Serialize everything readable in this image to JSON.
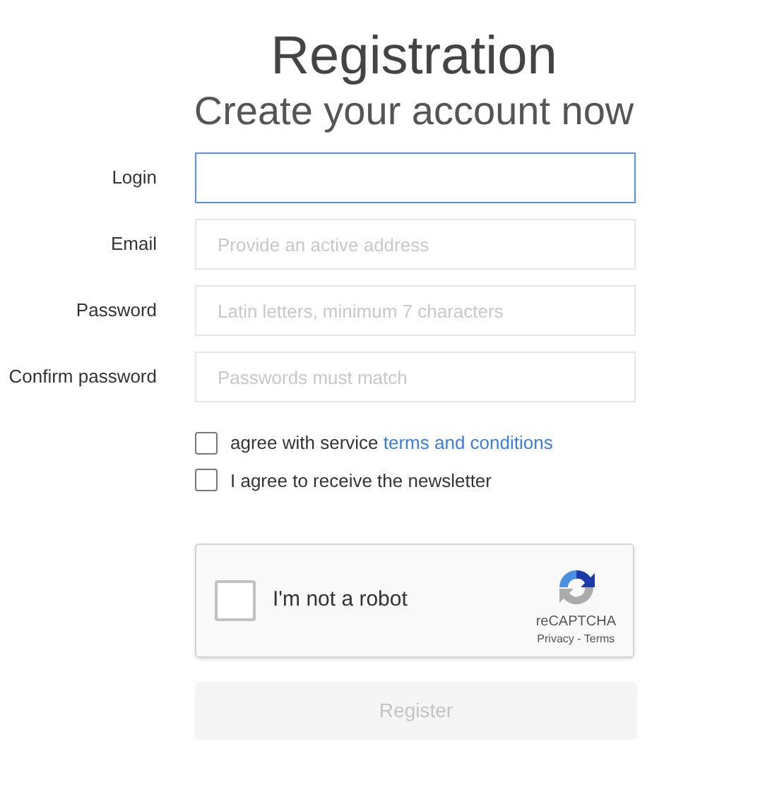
{
  "title": "Registration",
  "subtitle": "Create your account now",
  "fields": [
    {
      "label": "Login",
      "focused": true
    },
    {
      "label": "Email",
      "placeholder": "Provide an active address",
      "focused": false
    },
    {
      "label": "Password",
      "placeholder": "Latin letters, minimum 7 characters",
      "focused": false
    },
    {
      "label": "Confirm password",
      "placeholder": "Passwords must match",
      "focused": false
    }
  ],
  "checkboxes": [
    {
      "text": "agree with service",
      "link": "terms and conditions",
      "checked": false
    },
    {
      "text": "I agree to receive the newsletter",
      "checked": false
    }
  ],
  "captcha": {
    "label": "I'm not a robot",
    "checked": false,
    "brand": "reCAPTCHA",
    "links": "Privacy - Terms"
  },
  "submit": {
    "label": "Register",
    "disabled": true
  }
}
